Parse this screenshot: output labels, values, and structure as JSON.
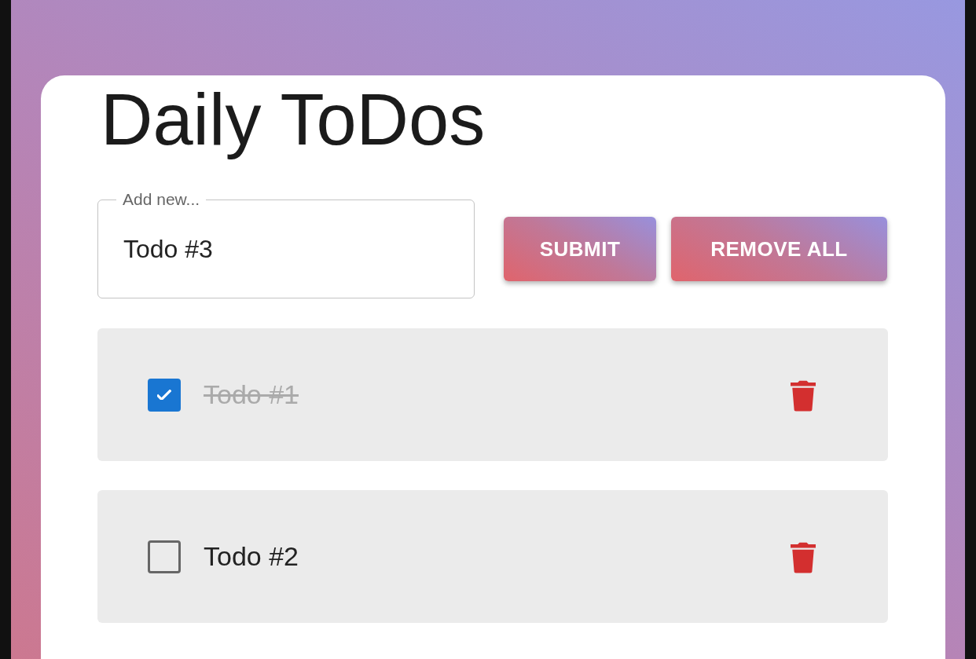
{
  "title": "Daily ToDos",
  "input": {
    "label": "Add new...",
    "value": "Todo #3"
  },
  "buttons": [
    {
      "label": "SUBMIT"
    },
    {
      "label": "REMOVE ALL"
    }
  ],
  "todos": [
    {
      "text": "Todo #1",
      "checked": true
    },
    {
      "text": "Todo #2",
      "checked": false
    }
  ]
}
